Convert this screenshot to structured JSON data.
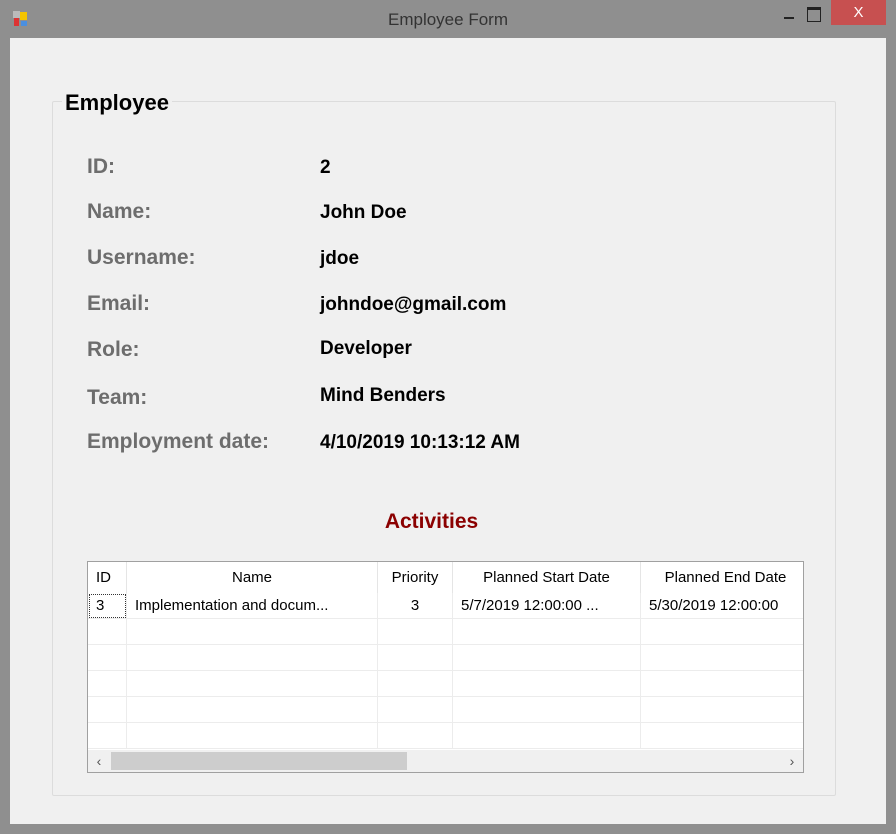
{
  "window": {
    "title": "Employee Form",
    "close_label": "X"
  },
  "group": {
    "title": "Employee"
  },
  "fields": [
    {
      "label": "ID:",
      "value": "2"
    },
    {
      "label": "Name:",
      "value": "John Doe"
    },
    {
      "label": "Username:",
      "value": "jdoe"
    },
    {
      "label": "Email:",
      "value": "johndoe@gmail.com"
    },
    {
      "label": "Role:",
      "value": "Developer"
    },
    {
      "label": "Team:",
      "value": "Mind Benders"
    },
    {
      "label": "Employment date:",
      "value": "4/10/2019 10:13:12 AM"
    }
  ],
  "activities": {
    "title": "Activities",
    "columns": [
      "ID",
      "Name",
      "Priority",
      "Planned Start Date",
      "Planned End Date"
    ],
    "rows": [
      [
        "3",
        "Implementation and docum...",
        "3",
        "5/7/2019 12:00:00 ...",
        "5/30/2019 12:00:00"
      ]
    ],
    "scroll_left": "‹",
    "scroll_right": "›"
  },
  "colors": {
    "accent": "#8b0000",
    "close": "#c75050"
  }
}
